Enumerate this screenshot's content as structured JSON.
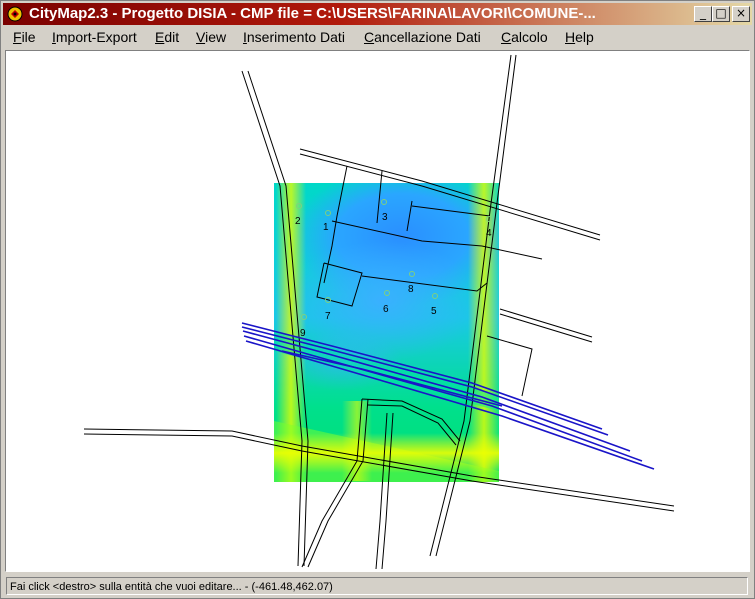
{
  "window": {
    "title": "CityMap2.3 - Progetto DISIA - CMP file = C:\\USERS\\FARINA\\LAVORI\\COMUNE-...",
    "controls": {
      "minimize": "_",
      "maximize": "□",
      "close": "×"
    }
  },
  "menu": [
    {
      "label": "File",
      "mnemonic": "F",
      "rest": "ile"
    },
    {
      "label": "Import-Export",
      "mnemonic": "I",
      "rest": "mport-Export"
    },
    {
      "label": "Edit",
      "mnemonic": "E",
      "rest": "dit"
    },
    {
      "label": "View",
      "mnemonic": "V",
      "rest": "iew"
    },
    {
      "label": "Inserimento Dati",
      "mnemonic": "I",
      "rest": "nserimento Dati"
    },
    {
      "label": "Cancellazione Dati",
      "mnemonic": "C",
      "rest": "ancellazione Dati"
    },
    {
      "label": "Calcolo",
      "mnemonic": "C",
      "rest": "alcolo"
    },
    {
      "label": "Help",
      "mnemonic": "H",
      "rest": "elp"
    }
  ],
  "map": {
    "receivers": [
      {
        "label": "1"
      },
      {
        "label": "2"
      },
      {
        "label": "3"
      },
      {
        "label": "4"
      },
      {
        "label": "5"
      },
      {
        "label": "6"
      },
      {
        "label": "7"
      },
      {
        "label": "8"
      },
      {
        "label": "9"
      }
    ],
    "colors": {
      "roads": "#000000",
      "railway": "#1a14c8",
      "markers": "#7fd07f",
      "grid_high": "#ffff00",
      "grid_mid": "#00e68c",
      "grid_low": "#2a8fff"
    }
  },
  "status": {
    "text": "Fai click <destro> sulla entità che vuoi editare... - (-461.48,462.07)"
  }
}
